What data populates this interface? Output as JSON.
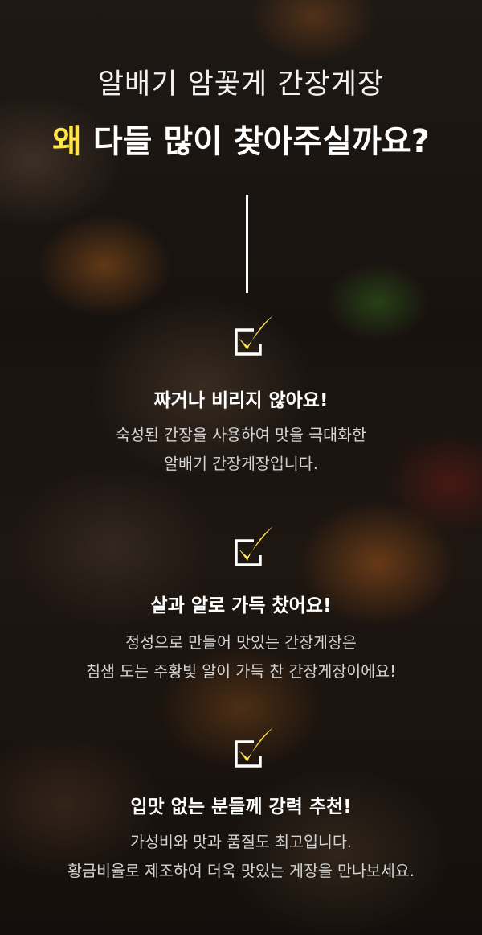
{
  "header": {
    "subtitle": "알배기 암꽃게 간장게장",
    "title_highlight": "왜",
    "title_rest": " 다들 많이 찾아주실까요?"
  },
  "colors": {
    "highlight": "#ffe54a",
    "check": "#ffe54a"
  },
  "features": [
    {
      "icon": "check-box-icon",
      "heading": "짜거나 비리지 않아요!",
      "lines": [
        "숙성된 간장을 사용하여 맛을 극대화한",
        "알배기 간장게장입니다."
      ]
    },
    {
      "icon": "check-box-icon",
      "heading": "살과 알로 가득 찼어요!",
      "lines": [
        "정성으로 만들어 맛있는 간장게장은",
        "침샘 도는 주황빛 알이 가득 찬 간장게장이에요!"
      ]
    },
    {
      "icon": "check-box-icon",
      "heading": "입맛 없는 분들께 강력 추천!",
      "lines": [
        "가성비와 맛과 품질도 최고입니다.",
        "황금비율로 제조하여 더욱 맛있는 게장을 만나보세요."
      ]
    }
  ]
}
